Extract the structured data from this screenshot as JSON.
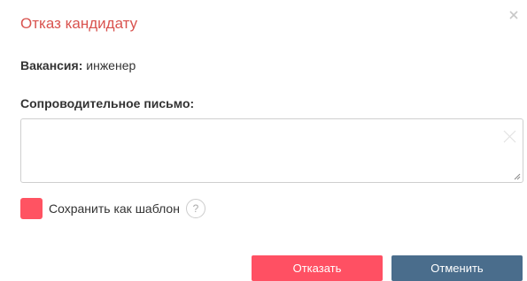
{
  "dialog": {
    "title": "Отказ кандидату",
    "close_icon": "close-icon"
  },
  "vacancy": {
    "label": "Вакансия:",
    "value": "инженер"
  },
  "cover_letter": {
    "label": "Сопроводительное письмо:",
    "value": "",
    "placeholder": ""
  },
  "save_template": {
    "label": "Сохранить как шаблон",
    "help_glyph": "?",
    "checkbox_color": "#ff5362"
  },
  "actions": {
    "reject_label": "Отказать",
    "cancel_label": "Отменить"
  },
  "colors": {
    "title": "#d9534f",
    "reject": "#ff5063",
    "cancel": "#4a6d8c"
  }
}
